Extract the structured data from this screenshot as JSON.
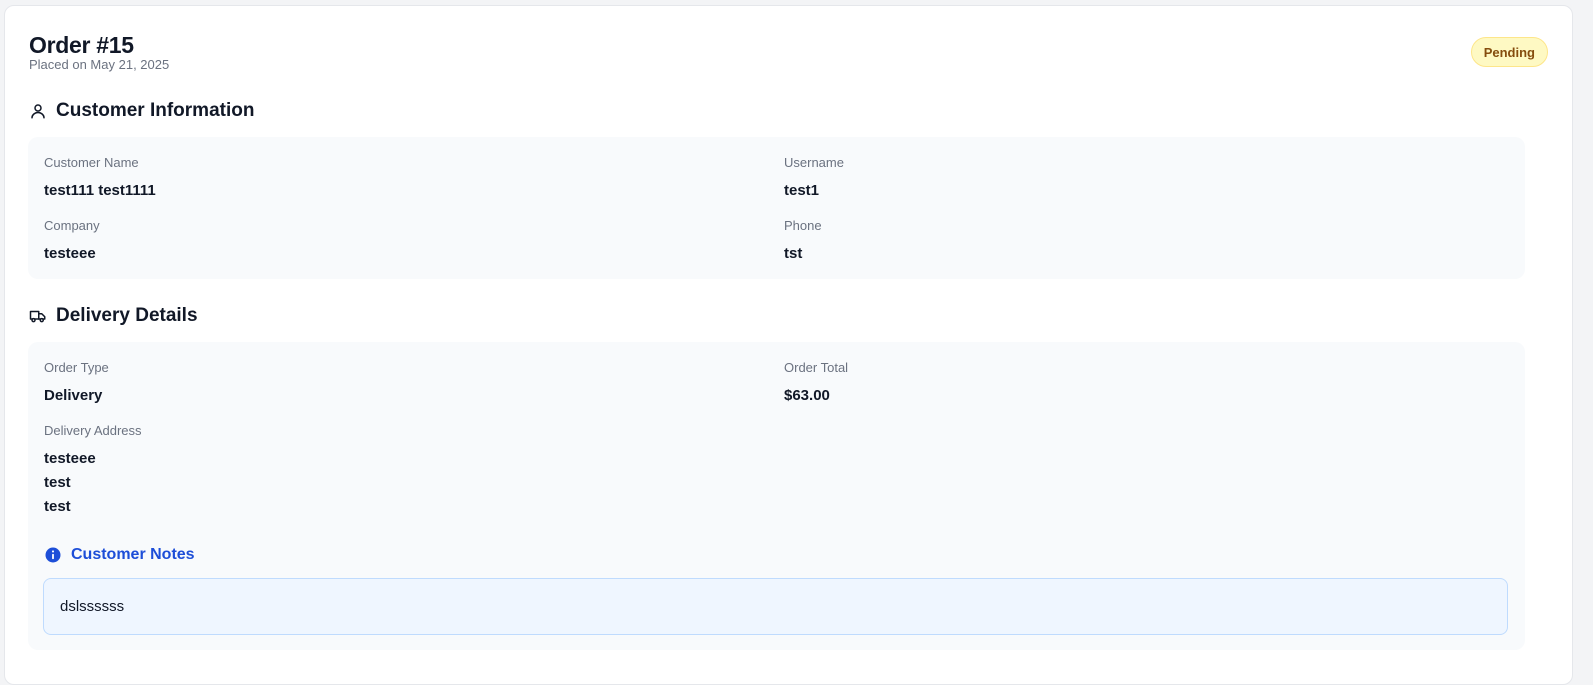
{
  "order": {
    "title": "Order #15",
    "placed": "Placed on May 21, 2025",
    "status": "Pending"
  },
  "customer": {
    "heading": "Customer Information",
    "icon": "user-icon",
    "name_label": "Customer Name",
    "name_value": "test111 test1111",
    "username_label": "Username",
    "username_value": "test1",
    "company_label": "Company",
    "company_value": "testeee",
    "phone_label": "Phone",
    "phone_value": "tst"
  },
  "delivery": {
    "heading": "Delivery Details",
    "icon": "truck-icon",
    "type_label": "Order Type",
    "type_value": "Delivery",
    "total_label": "Order Total",
    "total_value": "$63.00",
    "address_label": "Delivery Address",
    "address_lines": [
      "testeee",
      "test",
      "test"
    ]
  },
  "notes": {
    "heading": "Customer Notes",
    "icon": "info-icon",
    "text": "dslssssss"
  },
  "colors": {
    "badge_bg": "#fef9c3",
    "badge_text": "#854d0e",
    "notes_accent": "#1d4ed8",
    "panel_bg": "#f8fafc"
  }
}
